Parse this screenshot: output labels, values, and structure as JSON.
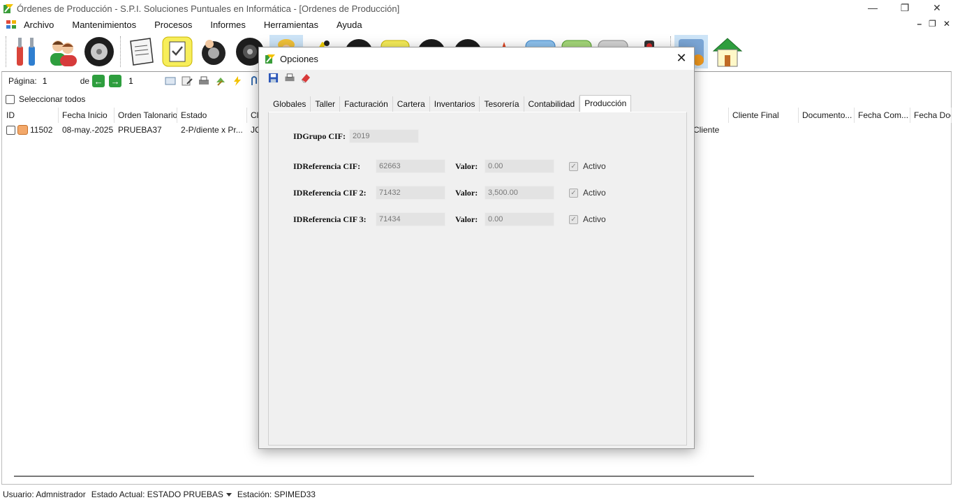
{
  "window": {
    "title": "Órdenes de Producción - S.P.I. Soluciones Puntuales en Informática - [Ordenes de Producción]",
    "minimize": "—",
    "restore": "❐",
    "close": "✕"
  },
  "menu": {
    "items": [
      "Archivo",
      "Mantenimientos",
      "Procesos",
      "Informes",
      "Herramientas",
      "Ayuda"
    ],
    "mdi": {
      "minimize": "–",
      "restore": "❐",
      "close": "✕"
    }
  },
  "nav": {
    "page_label": "Página:",
    "page_value": "1",
    "of_label": "de",
    "total_pages": "1",
    "prev": "←",
    "next": "→"
  },
  "select_all_label": "Seleccionar todos",
  "grid": {
    "headers": [
      "ID",
      "Fecha Inicio",
      "Orden Talonario",
      "Estado",
      "Cli",
      "Cliente Final",
      "Documento...",
      "Fecha Com...",
      "Fecha Doc..."
    ],
    "row": {
      "id": "11502",
      "fecha_inicio": "08-may.-2025",
      "orden_talonario": "PRUEBA37",
      "estado": "2-P/diente x Pr...",
      "cli": "JC",
      "hidden_col_tail": "Cliente"
    }
  },
  "status": {
    "usuario": "Usuario: Admnistrador",
    "estado": "Estado Actual: ESTADO PRUEBAS",
    "estacion": "Estación: SPIMED33"
  },
  "dialog": {
    "title": "Opciones",
    "close": "✕",
    "tabs": [
      "Globales",
      "Taller",
      "Facturación",
      "Cartera",
      "Inventarios",
      "Tesorería",
      "Contabilidad",
      "Producción"
    ],
    "active_tab": "Producción",
    "grupo_label": "IDGrupo CIF:",
    "grupo_value": "2019",
    "rows": [
      {
        "label": "IDReferencia CIF:",
        "ref": "62663",
        "valor_label": "Valor:",
        "valor": "0.00",
        "activo": "Activo"
      },
      {
        "label": "IDReferencia CIF 2:",
        "ref": "71432",
        "valor_label": "Valor:",
        "valor": "3,500.00",
        "activo": "Activo"
      },
      {
        "label": "IDReferencia CIF 3:",
        "ref": "71434",
        "valor_label": "Valor:",
        "valor": "0.00",
        "activo": "Activo"
      }
    ]
  },
  "colors": {
    "accent_green": "#2e9e3e",
    "selected_tool": "#cde4f7",
    "dialog_bg": "#f0f0f0"
  },
  "icons": [
    "app-logo-icon",
    "tools-icon",
    "users-icon",
    "tire-icon",
    "document-icon",
    "checklist-icon",
    "worker-icon",
    "wheel-icon",
    "save-icon",
    "print-icon",
    "eraser-icon",
    "home-icon"
  ]
}
